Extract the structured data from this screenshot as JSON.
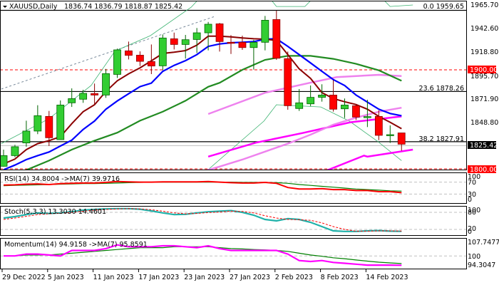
{
  "header": {
    "arrow_icon": "triangle-down-icon",
    "symbol": "XAUUSD,Daily",
    "ohlc": "1836.74 1836.79 1818.87 1825.42"
  },
  "fib_labels": [
    "0.0 1959.65",
    "23.6 1878.26",
    "38.2 1827.91"
  ],
  "price_axis": {
    "ticks": [
      "1965.70",
      "1942.60",
      "1918.80",
      "1895.70",
      "1871.90",
      "1848.80"
    ],
    "badge_1900": "1900.00",
    "badge_current": "1825.42",
    "badge_1800": "1800.00"
  },
  "rsi": {
    "label": "RSI(14) 34.8004  ->MA(7) 39.9716",
    "ticks": [
      "100",
      "70",
      "30",
      "0"
    ]
  },
  "stoch": {
    "label": "Stoch(5,3,3) 13.3030 14.4601",
    "ticks": [
      "100",
      "80",
      "20",
      "0"
    ]
  },
  "momentum": {
    "label": "Momentum(14) 94.9158  ->MA(7) 95.8591",
    "ticks": [
      "107.7477",
      "100",
      "94.3047"
    ]
  },
  "x_axis": {
    "labels": [
      "29 Dec 2022",
      "5 Jan 2023",
      "11 Jan 2023",
      "17 Jan 2023",
      "23 Jan 2023",
      "27 Jan 2023",
      "2 Feb 2023",
      "8 Feb 2023",
      "14 Feb 2023"
    ]
  },
  "colors": {
    "bull": "#32cd32",
    "bull_border": "#006400",
    "bear": "#ff0000",
    "bear_border": "#8b0000",
    "ma_fast": "#8b0000",
    "ma_blue": "#0000ff",
    "ma_green": "#228b22",
    "ma_violet": "#ee82ee",
    "ma_magenta": "#ff00ff",
    "band": "#3cb371",
    "level_red": "#ff0000"
  },
  "chart_data": {
    "type": "candlestick",
    "title": "XAUUSD,Daily",
    "ylim": [
      1800,
      1965.7
    ],
    "x_label_candle_index": [
      0,
      4,
      8,
      12,
      16,
      20,
      24,
      28,
      32
    ],
    "candles": [
      [
        1803.3,
        1820.0,
        1802.9,
        1814.0
      ],
      [
        1814.0,
        1824.8,
        1812.4,
        1822.9
      ],
      [
        1826.7,
        1849.0,
        1822.9,
        1838.6
      ],
      [
        1838.6,
        1864.5,
        1835.5,
        1854.0
      ],
      [
        1853.3,
        1858.8,
        1823.6,
        1831.9
      ],
      [
        1830.0,
        1869.3,
        1830.0,
        1864.7
      ],
      [
        1866.9,
        1881.4,
        1862.8,
        1871.1
      ],
      [
        1870.5,
        1880.0,
        1866.9,
        1876.4
      ],
      [
        1876.2,
        1886.2,
        1865.7,
        1874.7
      ],
      [
        1874.7,
        1900.9,
        1871.9,
        1896.2
      ],
      [
        1895.4,
        1921.2,
        1891.9,
        1920.0
      ],
      [
        1919.0,
        1928.3,
        1910.4,
        1914.5
      ],
      [
        1914.7,
        1918.5,
        1903.8,
        1908.5
      ],
      [
        1908.3,
        1925.4,
        1895.7,
        1903.8
      ],
      [
        1904.0,
        1935.4,
        1899.7,
        1931.9
      ],
      [
        1931.1,
        1937.3,
        1920.4,
        1925.4
      ],
      [
        1925.4,
        1935.0,
        1911.2,
        1930.2
      ],
      [
        1930.4,
        1941.9,
        1916.9,
        1937.1
      ],
      [
        1937.1,
        1948.0,
        1919.5,
        1945.7
      ],
      [
        1946.1,
        1947.0,
        1918.3,
        1928.3
      ],
      [
        1927.6,
        1934.7,
        1915.9,
        1927.4
      ],
      [
        1927.6,
        1934.2,
        1920.0,
        1922.3
      ],
      [
        1922.3,
        1930.0,
        1900.2,
        1927.6
      ],
      [
        1927.6,
        1954.0,
        1919.5,
        1949.7
      ],
      [
        1950.4,
        1959.2,
        1910.0,
        1911.6
      ],
      [
        1911.2,
        1918.3,
        1860.0,
        1864.0
      ],
      [
        1861.2,
        1880.7,
        1858.8,
        1866.9
      ],
      [
        1865.9,
        1884.3,
        1863.6,
        1872.4
      ],
      [
        1872.4,
        1885.5,
        1868.1,
        1874.7
      ],
      [
        1874.7,
        1889.7,
        1858.1,
        1860.5
      ],
      [
        1860.9,
        1871.2,
        1851.7,
        1864.7
      ],
      [
        1864.0,
        1865.2,
        1849.7,
        1852.6
      ],
      [
        1852.9,
        1870.0,
        1842.6,
        1853.1
      ],
      [
        1853.3,
        1859.3,
        1829.5,
        1834.3
      ],
      [
        1834.8,
        1844.3,
        1826.7,
        1835.0
      ],
      [
        1836.74,
        1836.79,
        1818.87,
        1825.42
      ]
    ],
    "ma_fast": [
      1805.7,
      1810.5,
      1820,
      1826,
      1829,
      1833,
      1846,
      1858,
      1865,
      1878.3,
      1889,
      1896,
      1902,
      1909,
      1916.4,
      1917.6,
      1919.3,
      1924.7,
      1933.8,
      1933.8,
      1933,
      1931.9,
      1931.1,
      1930.7,
      1929.5,
      1915.2,
      1900.9,
      1891.4,
      1877.1,
      1871.2,
      1868,
      1865.2,
      1860.5,
      1853.3,
      1847.4,
      1841
    ],
    "ma_blue": [
      1799.8,
      1804.5,
      1810,
      1814,
      1817.6,
      1823.6,
      1829.5,
      1840.2,
      1848.6,
      1860.5,
      1868.8,
      1876,
      1883.1,
      1886.6,
      1898.5,
      1904.5,
      1909.2,
      1915.2,
      1923.5,
      1925.9,
      1927.1,
      1927.6,
      1928.3,
      1930.7,
      1931.1,
      1923.5,
      1915.2,
      1906.9,
      1898.5,
      1890.2,
      1884.3,
      1874.7,
      1867.6,
      1860.5,
      1856.2,
      1854.0
    ],
    "ma_green": [
      [
        0,
        1795
      ],
      [
        2,
        1799.5
      ],
      [
        4,
        1809
      ],
      [
        6,
        1820
      ],
      [
        8,
        1829
      ],
      [
        10,
        1837
      ],
      [
        12,
        1849
      ],
      [
        14,
        1858
      ],
      [
        16,
        1869
      ],
      [
        18,
        1883
      ],
      [
        19,
        1887
      ],
      [
        21,
        1900
      ],
      [
        23,
        1910
      ],
      [
        25,
        1914
      ],
      [
        27,
        1914
      ],
      [
        29,
        1911
      ],
      [
        31,
        1906
      ],
      [
        33,
        1899.5
      ],
      [
        35,
        1889
      ]
    ],
    "ma_violet": [
      [
        17.8,
        1799
      ],
      [
        19,
        1803
      ],
      [
        21,
        1810
      ],
      [
        23,
        1818
      ],
      [
        25,
        1826
      ],
      [
        27,
        1835
      ],
      [
        29,
        1845
      ],
      [
        31,
        1852
      ],
      [
        33,
        1858
      ],
      [
        35,
        1862
      ]
    ],
    "ma_violet_b": [
      [
        18,
        1855.7
      ],
      [
        23,
        1877
      ],
      [
        26.8,
        1886.6
      ],
      [
        29.3,
        1892.6
      ],
      [
        33,
        1895
      ],
      [
        35,
        1893.8
      ]
    ],
    "ma_magenta": [
      [
        28.4,
        1799
      ],
      [
        31.7,
        1814
      ],
      [
        32,
        1813
      ],
      [
        36,
        1820
      ]
    ],
    "ma_magenta_b": [
      [
        18,
        1813
      ],
      [
        22.2,
        1827
      ],
      [
        26.3,
        1836.6
      ],
      [
        30.5,
        1847.4
      ],
      [
        35,
        1853.3
      ]
    ],
    "band_upper": [
      [
        -0.2,
        1826
      ],
      [
        4,
        1851
      ],
      [
        7.7,
        1884.3
      ],
      [
        9.8,
        1918.8
      ],
      [
        12.9,
        1934.2
      ],
      [
        16.5,
        1962.8
      ],
      [
        17.5,
        1975
      ],
      [
        23.2,
        1975
      ],
      [
        24,
        1963.5
      ],
      [
        26.5,
        1963.5
      ],
      [
        27.5,
        1975
      ],
      [
        33,
        1975
      ],
      [
        34,
        1963.5
      ],
      [
        36,
        1965
      ]
    ],
    "band_lower": [
      [
        17.9,
        1799
      ],
      [
        22.9,
        1848.6
      ],
      [
        24,
        1865
      ],
      [
        27.9,
        1862.8
      ],
      [
        30.4,
        1848.6
      ],
      [
        32.9,
        1828.3
      ],
      [
        35,
        1809
      ]
    ],
    "trendline": [
      [
        -0.2,
        1880.7
      ],
      [
        18.6,
        1953.6
      ]
    ],
    "levels": {
      "fib_0": 1959.65,
      "fib_23_6": 1878.26,
      "fib_38_2": 1827.91,
      "red_1900": 1900,
      "red_1800": 1800,
      "current": 1825.42
    },
    "rsi": [
      60,
      61,
      63,
      64,
      62,
      65,
      66,
      67,
      67,
      69,
      72,
      71,
      70,
      70,
      71,
      71,
      71,
      71,
      72,
      70,
      68,
      67,
      67,
      69,
      66,
      52,
      47,
      47,
      48,
      45,
      45,
      42,
      42,
      38,
      38,
      34.8
    ],
    "rsi_ma": [
      58,
      59,
      60,
      61,
      62,
      63,
      64,
      65,
      65,
      66,
      67,
      68,
      69,
      70,
      70,
      70,
      70,
      70,
      70,
      70,
      70,
      69,
      69,
      69,
      68,
      66,
      62,
      59,
      56,
      53,
      50,
      47,
      45,
      43,
      41,
      39.97
    ],
    "stoch_main": [
      60,
      65,
      72,
      78,
      76,
      78,
      82,
      88,
      90,
      92,
      93,
      93,
      91,
      85,
      78,
      72,
      73,
      78,
      82,
      84,
      86,
      80,
      70,
      55,
      50,
      58,
      55,
      45,
      30,
      15,
      13,
      13,
      15,
      16,
      14,
      13.3
    ],
    "stoch_signal": [
      55,
      60,
      66,
      72,
      75,
      77,
      80,
      84,
      88,
      90,
      92,
      93,
      92,
      89,
      84,
      78,
      75,
      76,
      79,
      81,
      84,
      83,
      78,
      68,
      60,
      55,
      54,
      52,
      43,
      30,
      20,
      14,
      14,
      15,
      15,
      14.46
    ],
    "momentum": [
      100,
      100,
      101,
      101,
      100.5,
      100,
      103,
      103,
      103,
      104,
      106,
      105,
      105,
      105,
      105.5,
      105.5,
      105,
      104.5,
      105.5,
      104,
      103,
      103,
      103,
      103,
      103,
      101,
      97.5,
      97,
      97.5,
      96.5,
      96,
      95.5,
      95,
      95,
      95,
      94.92
    ],
    "momentum_ma": [
      100,
      100,
      100.5,
      100.5,
      100.5,
      101,
      101.5,
      102,
      102.5,
      103,
      103.5,
      104,
      104.5,
      104.5,
      104.5,
      105,
      105,
      105,
      105,
      104.5,
      104,
      103.8,
      103.5,
      103.3,
      103,
      102.5,
      101.5,
      100.5,
      99.8,
      99,
      98.5,
      97.8,
      97.2,
      96.6,
      96.2,
      95.86
    ]
  }
}
